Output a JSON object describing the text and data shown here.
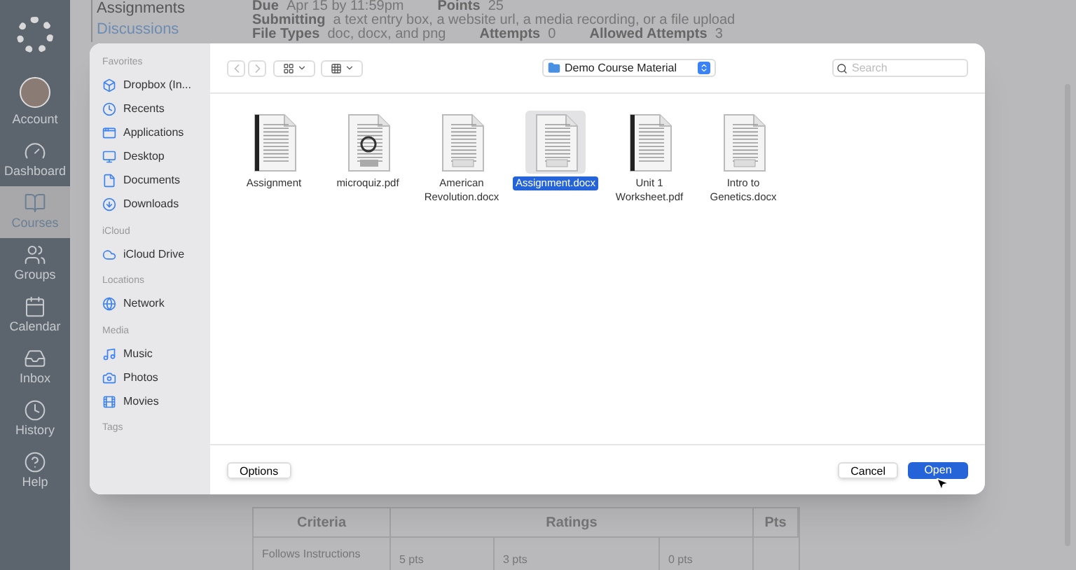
{
  "nav": {
    "items": [
      {
        "label": "Account",
        "selected": false
      },
      {
        "label": "Dashboard",
        "selected": false
      },
      {
        "label": "Courses",
        "selected": true
      },
      {
        "label": "Groups",
        "selected": false
      },
      {
        "label": "Calendar",
        "selected": false
      },
      {
        "label": "Inbox",
        "selected": false
      },
      {
        "label": "History",
        "selected": false
      },
      {
        "label": "Help",
        "selected": false
      }
    ]
  },
  "course_nav": [
    {
      "label": "Assignments",
      "selected": true
    },
    {
      "label": "Discussions",
      "selected": false
    }
  ],
  "details": [
    [
      {
        "label": "Due",
        "value": "Apr 15 by 11:59pm"
      },
      {
        "label": "Points",
        "value": "25"
      }
    ],
    [
      {
        "label": "Submitting",
        "value": "a text entry box, a website url, a media recording, or a file upload"
      }
    ],
    [
      {
        "label": "File Types",
        "value": "doc, docx, and png"
      },
      {
        "label": "Attempts",
        "value": "0"
      },
      {
        "label": "Allowed Attempts",
        "value": "3"
      }
    ]
  ],
  "rubric": {
    "columns": [
      "Criteria",
      "Ratings",
      "Pts"
    ],
    "rows": [
      {
        "criterion": "Follows Instructions",
        "ratings": [
          "5 pts",
          "3 pts",
          "0 pts"
        ]
      }
    ]
  },
  "dialog": {
    "sidebar": [
      {
        "heading": "Favorites",
        "items": [
          "Dropbox (In...",
          "Recents",
          "Applications",
          "Desktop",
          "Documents",
          "Downloads"
        ]
      },
      {
        "heading": "iCloud",
        "items": [
          "iCloud Drive"
        ]
      },
      {
        "heading": "Locations",
        "items": [
          "Network"
        ]
      },
      {
        "heading": "Media",
        "items": [
          "Music",
          "Photos",
          "Movies"
        ]
      },
      {
        "heading": "Tags"
      }
    ],
    "folder": "Demo Course Material",
    "search": {
      "placeholder": "Search"
    },
    "files": [
      {
        "name": "Assignment",
        "kind": "pages",
        "selected": false
      },
      {
        "name": "microquiz.pdf",
        "kind": "pdf",
        "selected": false
      },
      {
        "name": "American Revolution.docx",
        "kind": "docx",
        "selected": false
      },
      {
        "name": "Assignment.docx",
        "kind": "docx",
        "selected": true
      },
      {
        "name": "Unit 1 Worksheet.pdf",
        "kind": "pages",
        "selected": false
      },
      {
        "name": "Intro to Genetics.docx",
        "kind": "docx",
        "selected": false
      }
    ],
    "buttons": {
      "options": "Options",
      "cancel": "Cancel",
      "open": "Open"
    }
  }
}
